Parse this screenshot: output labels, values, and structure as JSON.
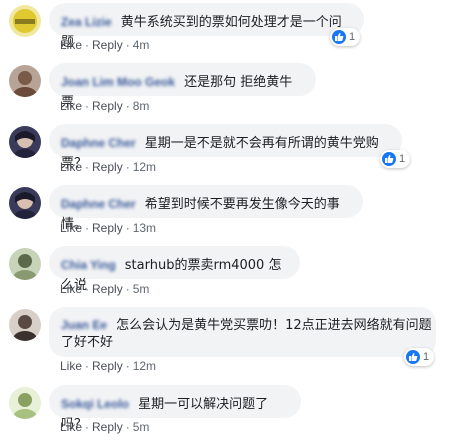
{
  "comments": [
    {
      "author": "Zea Lizie",
      "text": "黄牛系统买到的票如何处理才是一个问题",
      "actions": {
        "like": "Like",
        "reply": "Reply",
        "time": "4m"
      },
      "reactions": "1",
      "avatar_color": "#e8d24a"
    },
    {
      "author": "Joan Lim Moo Geok",
      "text": "还是那句 拒绝黄牛票",
      "actions": {
        "like": "Like",
        "reply": "Reply",
        "time": "8m"
      },
      "avatar_color": "#8a6a58"
    },
    {
      "author": "Daphne Cher",
      "text": "星期一是不是就不会再有所谓的黄牛党购票？",
      "actions": {
        "like": "Like",
        "reply": "Reply",
        "time": "12m"
      },
      "reactions": "1",
      "avatar_color": "#2c2c44"
    },
    {
      "author": "Daphne Cher",
      "text": "希望到时候不要再发生像今天的事情。",
      "actions": {
        "like": "Like",
        "reply": "Reply",
        "time": "13m"
      },
      "avatar_color": "#2c2c44"
    },
    {
      "author": "Chia Ying",
      "text": "starhub的票卖rm4000 怎么说",
      "actions": {
        "like": "Like",
        "reply": "Reply",
        "time": "5m"
      },
      "avatar_color": "#6f8a66"
    },
    {
      "author": "Juan Ee",
      "text_line1": "怎么会认为是黄牛党买票叻！12点正进去网络就有问题",
      "text_line2": "了好不好",
      "actions": {
        "like": "Like",
        "reply": "Reply",
        "time": "12m"
      },
      "reactions": "1",
      "avatar_color": "#7a6c66"
    },
    {
      "author": "Sokqi Leolo",
      "text": "星期一可以解决问题了吗？",
      "actions": {
        "like": "Like",
        "reply": "Reply",
        "time": "5m"
      },
      "avatar_color": "#9ab070"
    }
  ],
  "separator": "·",
  "colors": {
    "bubble": "#f2f3f5",
    "author": "#385898",
    "link": "#4b4f56",
    "like_blue": "#1877f2"
  },
  "icons": {
    "reaction": "thumbs-up-icon"
  }
}
